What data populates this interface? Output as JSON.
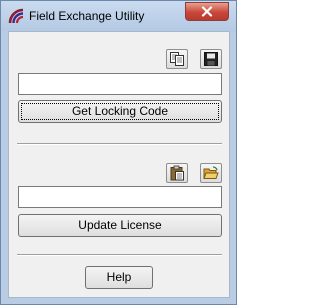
{
  "window": {
    "title": "Field Exchange Utility",
    "close_icon": "close-icon"
  },
  "locking": {
    "copy_icon": "copy-icon",
    "save_icon": "save-icon",
    "code_value": "",
    "button_label": "Get Locking Code"
  },
  "license": {
    "paste_icon": "paste-icon",
    "open_icon": "open-folder-icon",
    "license_value": "",
    "button_label": "Update License"
  },
  "footer": {
    "help_label": "Help"
  },
  "colors": {
    "title_bar": "#b8cce4",
    "client_bg": "#f0f0f0",
    "close_button": "#c9473a"
  }
}
